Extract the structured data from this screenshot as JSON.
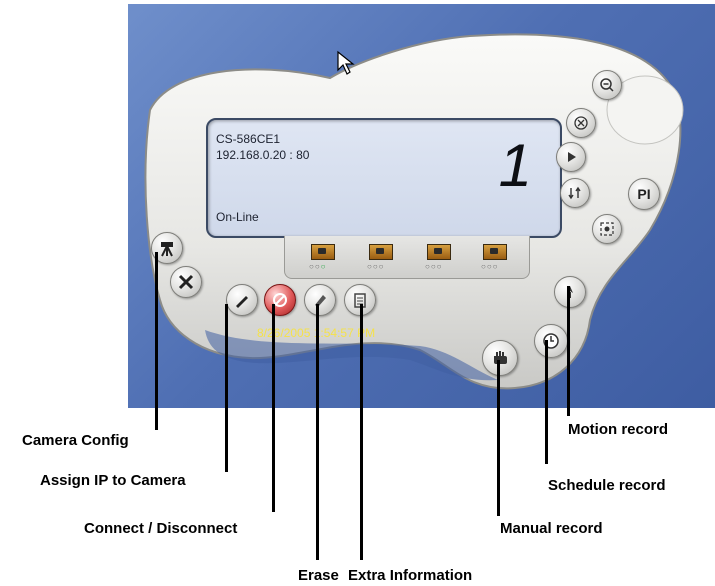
{
  "lcd": {
    "model": "CS-586CE1",
    "address": "192.168.0.20 : 80",
    "channel_number": "1",
    "status": "On-Line"
  },
  "timestamp": "8/26/2005 1:54:57 PM",
  "cameras": [
    {
      "dots": [
        "off",
        "off",
        "on"
      ]
    },
    {
      "dots": [
        "off",
        "off",
        "off"
      ]
    },
    {
      "dots": [
        "off",
        "off",
        "off"
      ]
    },
    {
      "dots": [
        "off",
        "off",
        "off"
      ]
    }
  ],
  "right_controls": {
    "zoom_out_icon": "magnifier-minus",
    "close_icon": "x-circle",
    "play_icon": "triangle",
    "swap_icon": "arrow-swap",
    "snapshot_icon": "target",
    "pi_label": "PI"
  },
  "callouts": {
    "camera_config": "Camera Config",
    "assign_ip": "Assign IP to Camera",
    "connect_disconnect": "Connect / Disconnect",
    "erase": "Erase",
    "extra_information": "Extra Information",
    "motion_record": "Motion record",
    "schedule_record": "Schedule record",
    "manual_record": "Manual record"
  },
  "colors": {
    "desktop": "#5677bb",
    "timestamp": "#f5e24a",
    "online_dot": "#2ea84a",
    "connect_button": "#e05a5a"
  }
}
